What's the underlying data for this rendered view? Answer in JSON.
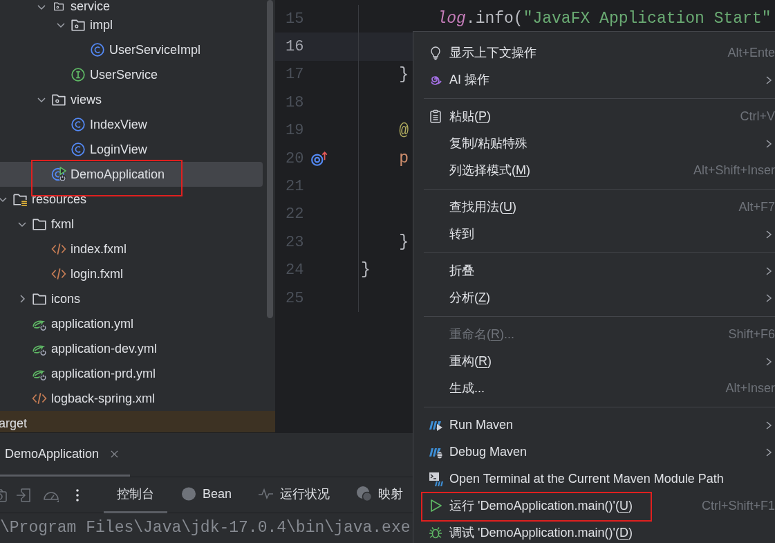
{
  "project_tree": {
    "package_items": [
      {
        "label": "service",
        "kind": "package",
        "expanded": true,
        "selected": false,
        "highlighted": false,
        "children": [
          {
            "label": "impl",
            "kind": "package",
            "expanded": true,
            "selected": false,
            "highlighted": false,
            "children": [
              {
                "label": "UserServiceImpl",
                "kind": "class",
                "selected": false,
                "highlighted": false
              }
            ]
          },
          {
            "label": "UserService",
            "kind": "interface",
            "selected": false,
            "highlighted": false
          }
        ]
      },
      {
        "label": "views",
        "kind": "package",
        "expanded": true,
        "selected": false,
        "highlighted": false,
        "children": [
          {
            "label": "IndexView",
            "kind": "class",
            "selected": false,
            "highlighted": false
          },
          {
            "label": "LoginView",
            "kind": "class",
            "selected": false,
            "highlighted": false
          }
        ]
      },
      {
        "label": "DemoApplication",
        "kind": "spring-main",
        "selected": true,
        "highlighted": true
      }
    ],
    "items": [
      {
        "label": "resources",
        "kind": "resources",
        "expanded": true,
        "selected": false,
        "highlighted": false,
        "children": [
          {
            "label": "fxml",
            "kind": "folder",
            "expanded": true,
            "selected": false,
            "highlighted": false,
            "children": [
              {
                "label": "index.fxml",
                "kind": "xml",
                "selected": false,
                "highlighted": false
              },
              {
                "label": "login.fxml",
                "kind": "xml",
                "selected": false,
                "highlighted": false
              }
            ]
          },
          {
            "label": "icons",
            "kind": "folder",
            "expanded": false,
            "selected": false,
            "highlighted": false
          },
          {
            "label": "application.yml",
            "kind": "yml",
            "selected": false,
            "highlighted": false
          },
          {
            "label": "application-dev.yml",
            "kind": "yml",
            "selected": false,
            "highlighted": false
          },
          {
            "label": "application-prd.yml",
            "kind": "yml",
            "selected": false,
            "highlighted": false
          },
          {
            "label": "logback-spring.xml",
            "kind": "xml",
            "selected": false,
            "highlighted": false
          }
        ]
      }
    ],
    "excluded_row": {
      "label": "arget"
    }
  },
  "editor": {
    "lines": [
      {
        "number": "15",
        "current": false,
        "tokens": [
          {
            "text": "        log",
            "kind": "field"
          },
          {
            "text": ".info(",
            "kind": "plain"
          },
          {
            "text": "\"JavaFX Application Start\"",
            "kind": "string"
          }
        ]
      },
      {
        "number": "16",
        "current": true
      },
      {
        "number": "17",
        "current": false,
        "tokens": [
          {
            "text": "    }",
            "kind": "plain"
          }
        ]
      },
      {
        "number": "18",
        "current": false
      },
      {
        "number": "19",
        "current": false,
        "tokens": [
          {
            "text": "    @",
            "kind": "annotation"
          }
        ]
      },
      {
        "number": "20",
        "current": false,
        "kind": "overriding",
        "tokens": [
          {
            "text": "    p",
            "kind": "keyword"
          }
        ]
      },
      {
        "number": "21",
        "current": false
      },
      {
        "number": "22",
        "current": false
      },
      {
        "number": "23",
        "current": false,
        "tokens": [
          {
            "text": "    }",
            "kind": "plain"
          }
        ]
      },
      {
        "number": "24",
        "current": false,
        "tokens": [
          {
            "text": "}",
            "kind": "plain"
          }
        ]
      },
      {
        "number": "25",
        "current": false
      }
    ]
  },
  "run_panel": {
    "tabs": [
      {
        "label": "DemoApplication",
        "selected": true,
        "closable": true
      }
    ],
    "view_tabs": [
      {
        "label": "控制台",
        "kind": "console",
        "selected": true
      },
      {
        "label": "Bean",
        "kind": "beans",
        "selected": false
      },
      {
        "label": "运行状况",
        "kind": "health",
        "selected": false
      },
      {
        "label": "映射",
        "kind": "mappings",
        "selected": false
      }
    ],
    "console": {
      "text": "\\Program Files\\Java\\jdk-17.0.4\\bin\\java.exe"
    }
  },
  "context_menu": {
    "items": [
      {
        "kind": "context-actions",
        "label": "显示上下文操作",
        "shortcut": "Alt+Ente",
        "submenu": false,
        "disabled": false,
        "highlighted": false
      },
      {
        "kind": "ai",
        "label": "AI 操作",
        "submenu": true,
        "disabled": false,
        "highlighted": false
      },
      {
        "kind": "separator"
      },
      {
        "kind": "paste",
        "label": "粘贴(",
        "mnemonic": "P",
        "label_end": ")",
        "shortcut": "Ctrl+V",
        "submenu": false,
        "disabled": false,
        "highlighted": false
      },
      {
        "kind": "plain",
        "label": "复制/粘贴特殊",
        "submenu": true,
        "disabled": false,
        "highlighted": false
      },
      {
        "kind": "plain",
        "label": "列选择模式(",
        "mnemonic": "M",
        "label_end": ")",
        "shortcut": "Alt+Shift+Inser",
        "submenu": false,
        "disabled": false,
        "highlighted": false
      },
      {
        "kind": "separator"
      },
      {
        "kind": "plain",
        "label": "查找用法(",
        "mnemonic": "U",
        "label_end": ")",
        "shortcut": "Alt+F7",
        "submenu": false,
        "disabled": false,
        "highlighted": false
      },
      {
        "kind": "plain",
        "label": "转到",
        "submenu": true,
        "disabled": false,
        "highlighted": false
      },
      {
        "kind": "separator"
      },
      {
        "kind": "plain",
        "label": "折叠",
        "submenu": true,
        "disabled": false,
        "highlighted": false
      },
      {
        "kind": "plain",
        "label": "分析(",
        "mnemonic": "Z",
        "label_end": ")",
        "submenu": true,
        "disabled": false,
        "highlighted": false
      },
      {
        "kind": "separator"
      },
      {
        "kind": "plain",
        "label": "重命名(",
        "mnemonic": "R",
        "label_end": ")...",
        "shortcut": "Shift+F6",
        "submenu": false,
        "disabled": true,
        "highlighted": false
      },
      {
        "kind": "plain",
        "label": "重构(",
        "mnemonic": "R",
        "label_end": ")",
        "submenu": true,
        "disabled": false,
        "highlighted": false
      },
      {
        "kind": "plain",
        "label": "生成...",
        "shortcut": "Alt+Inser",
        "submenu": false,
        "disabled": false,
        "highlighted": false
      },
      {
        "kind": "separator"
      },
      {
        "kind": "maven-run",
        "label": "Run Maven",
        "submenu": true,
        "disabled": false,
        "highlighted": false
      },
      {
        "kind": "maven-debug",
        "label": "Debug Maven",
        "submenu": true,
        "disabled": false,
        "highlighted": false
      },
      {
        "kind": "maven-terminal",
        "label": "Open Terminal at the Current Maven Module Path",
        "submenu": false,
        "disabled": false,
        "highlighted": false
      },
      {
        "kind": "run",
        "label": "运行 'DemoApplication.main()'(",
        "mnemonic": "U",
        "label_end": ")",
        "shortcut": "Ctrl+Shift+F1",
        "submenu": false,
        "disabled": false,
        "highlighted": true
      },
      {
        "kind": "debug",
        "label": "调试 'DemoApplication.main()'(",
        "mnemonic": "D",
        "label_end": ")",
        "submenu": false,
        "disabled": false,
        "highlighted": false
      }
    ]
  }
}
